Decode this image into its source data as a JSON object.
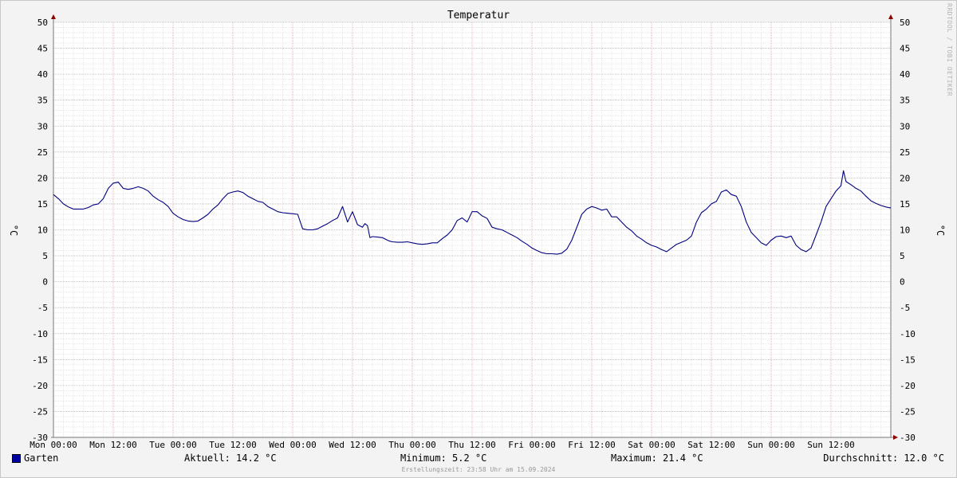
{
  "chart_data": {
    "type": "line",
    "title": "Temperatur",
    "ylabel": "°C",
    "ylabel_right": "°C",
    "ylim": [
      -30,
      50
    ],
    "y_ticks": [
      50,
      45,
      40,
      35,
      30,
      25,
      20,
      15,
      10,
      5,
      0,
      -5,
      -10,
      -15,
      -20,
      -25,
      -30
    ],
    "y_tick_labels": [
      "50",
      "45",
      "40",
      "35",
      "30",
      "25",
      "20",
      "15",
      "10",
      "5",
      "0",
      "-5",
      "-10",
      "-15",
      "-20",
      "-25",
      "-30"
    ],
    "x_unit": "hours",
    "xlim": [
      0,
      168
    ],
    "x_ticks": [
      0,
      12,
      24,
      36,
      48,
      60,
      72,
      84,
      96,
      108,
      120,
      132,
      144,
      156
    ],
    "x_tick_labels": [
      "Mon 00:00",
      "Mon 12:00",
      "Tue 00:00",
      "Tue 12:00",
      "Wed 00:00",
      "Wed 12:00",
      "Thu 00:00",
      "Thu 12:00",
      "Fri 00:00",
      "Fri 12:00",
      "Sat 00:00",
      "Sat 12:00",
      "Sun 00:00",
      "Sun 12:00"
    ],
    "grid": true,
    "series": [
      {
        "name": "Garten",
        "color": "#000080",
        "x": [
          0,
          1,
          2,
          3,
          4,
          5,
          6,
          7,
          8,
          9,
          10,
          11,
          12,
          13,
          14,
          15,
          16,
          17,
          18,
          19,
          20,
          21,
          22,
          23,
          24,
          25,
          26,
          27,
          28,
          29,
          30,
          31,
          32,
          33,
          34,
          35,
          36,
          37,
          38,
          39,
          40,
          41,
          42,
          43,
          44,
          45,
          46,
          47,
          48,
          49,
          50,
          51,
          52,
          53,
          54,
          55,
          56,
          57,
          58,
          59,
          60,
          61,
          62,
          62.5,
          63,
          63.5,
          64,
          65,
          66,
          67,
          67.5,
          68,
          69,
          70,
          71,
          72,
          73,
          74,
          75,
          76,
          77,
          78,
          79,
          80,
          81,
          82,
          83,
          84,
          85,
          86,
          87,
          88,
          89,
          90,
          91,
          92,
          93,
          94,
          95,
          96,
          97,
          98,
          99,
          100,
          101,
          102,
          103,
          104,
          105,
          106,
          107,
          108,
          109,
          110,
          111,
          112,
          113,
          114,
          115,
          116,
          117,
          118,
          119,
          120,
          121,
          122,
          123,
          124,
          125,
          126,
          127,
          128,
          129,
          130,
          131,
          132,
          133,
          134,
          135,
          136,
          137,
          138,
          139,
          140,
          141,
          142,
          143,
          144,
          145,
          146,
          147,
          148,
          149,
          150,
          151,
          152,
          153,
          154,
          155,
          156,
          157,
          158,
          158.5,
          159,
          160,
          161,
          162,
          163,
          164,
          165,
          166,
          167,
          168
        ],
        "values": [
          16.8,
          16.0,
          15.0,
          14.4,
          14.0,
          14.0,
          14.0,
          14.3,
          14.8,
          15.0,
          16.0,
          18.0,
          19.0,
          19.2,
          18.0,
          17.8,
          18.0,
          18.3,
          18.0,
          17.5,
          16.5,
          15.8,
          15.3,
          14.5,
          13.2,
          12.5,
          12.0,
          11.7,
          11.6,
          11.7,
          12.3,
          13.0,
          14.0,
          14.8,
          16.0,
          17.0,
          17.3,
          17.5,
          17.2,
          16.5,
          16.0,
          15.5,
          15.3,
          14.5,
          14.0,
          13.5,
          13.3,
          13.2,
          13.1,
          13.0,
          10.2,
          10.0,
          10.0,
          10.2,
          10.7,
          11.2,
          11.8,
          12.3,
          14.5,
          11.5,
          13.5,
          11.0,
          10.5,
          11.2,
          10.8,
          8.5,
          8.7,
          8.6,
          8.5,
          8.0,
          7.8,
          7.7,
          7.6,
          7.6,
          7.7,
          7.5,
          7.3,
          7.2,
          7.3,
          7.5,
          7.5,
          8.3,
          9.0,
          10.0,
          11.8,
          12.3,
          11.5,
          13.5,
          13.5,
          12.7,
          12.2,
          10.5,
          10.2,
          10.0,
          9.5,
          9.0,
          8.5,
          7.8,
          7.2,
          6.5,
          6.0,
          5.6,
          5.4,
          5.4,
          5.3,
          5.5,
          6.3,
          8.0,
          10.5,
          13.0,
          14.0,
          14.5,
          14.2,
          13.8,
          14.0,
          12.5,
          12.5,
          11.5,
          10.5,
          9.8,
          8.8,
          8.2,
          7.5,
          7.0,
          6.7,
          6.2,
          5.8,
          6.5,
          7.2,
          7.6,
          8.0,
          8.8,
          11.5,
          13.3,
          14.0,
          15.0,
          15.5,
          17.3,
          17.7,
          16.8,
          16.5,
          14.5,
          11.5,
          9.5,
          8.5,
          7.5,
          7.0,
          8.0,
          8.7,
          8.8,
          8.5,
          8.8,
          7.0,
          6.2,
          5.8,
          6.5,
          9.0,
          11.5,
          14.5,
          16.0,
          17.5,
          18.5,
          21.4,
          19.3,
          18.7,
          18.0,
          17.5,
          16.5,
          15.6,
          15.1,
          14.7,
          14.4,
          14.2
        ]
      }
    ]
  },
  "legend": {
    "swatch_color": "#0000a0",
    "label": "Garten"
  },
  "stats": {
    "current": "Aktuell: 14.2 °C",
    "minimum": "Minimum: 5.2 °C",
    "maximum": "Maximum: 21.4 °C",
    "average": "Durchschnitt: 12.0 °C"
  },
  "footer": {
    "created": "Erstellungszeit: 23:58 Uhr am 15.09.2024",
    "watermark": "RRDTOOL / TOBI OETIKER"
  },
  "colors": {
    "background": "#f3f3f3",
    "plot_background": "#ffffff",
    "major_grid": "#e7a1a1",
    "minor_grid": "#d8d8d8",
    "line": "#000080",
    "axis_arrow": "#8b0000"
  }
}
